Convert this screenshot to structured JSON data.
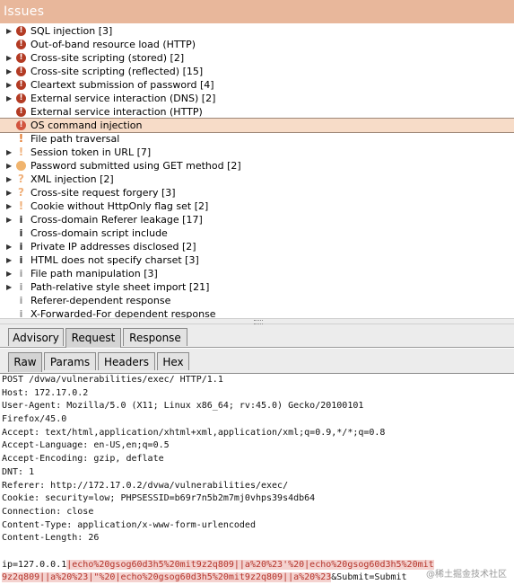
{
  "header": {
    "title": "Issues"
  },
  "issues": [
    {
      "label": "SQL injection [3]",
      "icon": "high-severity-icon",
      "severity": "high",
      "expandable": true
    },
    {
      "label": "Out-of-band resource load (HTTP)",
      "icon": "high-severity-icon",
      "severity": "high",
      "expandable": false
    },
    {
      "label": "Cross-site scripting (stored) [2]",
      "icon": "high-severity-icon",
      "severity": "high",
      "expandable": true
    },
    {
      "label": "Cross-site scripting (reflected) [15]",
      "icon": "high-severity-icon",
      "severity": "high",
      "expandable": true
    },
    {
      "label": "Cleartext submission of password [4]",
      "icon": "high-severity-icon",
      "severity": "high",
      "expandable": true
    },
    {
      "label": "External service interaction (DNS) [2]",
      "icon": "high-severity-icon",
      "severity": "high",
      "expandable": true
    },
    {
      "label": "External service interaction (HTTP)",
      "icon": "high-severity-icon",
      "severity": "high",
      "expandable": false
    },
    {
      "label": "OS command injection",
      "icon": "high-severity-icon",
      "severity": "high-selected",
      "expandable": false,
      "selected": true
    },
    {
      "label": "File path traversal",
      "icon": "medium-severity-icon",
      "severity": "medium",
      "expandable": false
    },
    {
      "label": "Session token in URL [7]",
      "icon": "low-severity-icon",
      "severity": "low",
      "expandable": true
    },
    {
      "label": "Password submitted using GET method [2]",
      "icon": "medium-circle-icon",
      "severity": "circle-orange",
      "expandable": true
    },
    {
      "label": "XML injection [2]",
      "icon": "question-icon",
      "severity": "low",
      "expandable": true
    },
    {
      "label": "Cross-site request forgery [3]",
      "icon": "question-icon",
      "severity": "low",
      "expandable": true
    },
    {
      "label": "Cookie without HttpOnly flag set [2]",
      "icon": "low-severity-icon",
      "severity": "low",
      "expandable": true
    },
    {
      "label": "Cross-domain Referer leakage [17]",
      "icon": "info-icon",
      "severity": "info",
      "expandable": true
    },
    {
      "label": "Cross-domain script include",
      "icon": "info-icon",
      "severity": "info",
      "expandable": false
    },
    {
      "label": "Private IP addresses disclosed [2]",
      "icon": "info-icon",
      "severity": "info",
      "expandable": true
    },
    {
      "label": "HTML does not specify charset [3]",
      "icon": "info-icon",
      "severity": "info",
      "expandable": true
    },
    {
      "label": "File path manipulation [3]",
      "icon": "info-icon",
      "severity": "info-faint",
      "expandable": true
    },
    {
      "label": "Path-relative style sheet import [21]",
      "icon": "info-icon",
      "severity": "info-faint",
      "expandable": true
    },
    {
      "label": "Referer-dependent response",
      "icon": "info-icon",
      "severity": "info-faint",
      "expandable": false
    },
    {
      "label": "X-Forwarded-For dependent response",
      "icon": "info-icon",
      "severity": "info-faint",
      "expandable": false
    }
  ],
  "tabs_top": [
    {
      "label": "Advisory",
      "active": false
    },
    {
      "label": "Request",
      "active": true
    },
    {
      "label": "Response",
      "active": false
    }
  ],
  "tabs_sub": [
    {
      "label": "Raw",
      "active": true
    },
    {
      "label": "Params",
      "active": false
    },
    {
      "label": "Headers",
      "active": false
    },
    {
      "label": "Hex",
      "active": false
    }
  ],
  "request": {
    "lines": [
      "POST /dvwa/vulnerabilities/exec/ HTTP/1.1",
      "Host: 172.17.0.2",
      "User-Agent: Mozilla/5.0 (X11; Linux x86_64; rv:45.0) Gecko/20100101",
      "Firefox/45.0",
      "Accept: text/html,application/xhtml+xml,application/xml;q=0.9,*/*;q=0.8",
      "Accept-Language: en-US,en;q=0.5",
      "Accept-Encoding: gzip, deflate",
      "DNT: 1",
      "Referer: http://172.17.0.2/dvwa/vulnerabilities/exec/",
      "Cookie: security=low; PHPSESSID=b69r7n5b2m7mj0vhps39s4db64",
      "Connection: close",
      "Content-Type: application/x-www-form-urlencoded",
      "Content-Length: 26",
      ""
    ],
    "body_line1_prefix": "ip=127.0.0.1",
    "body_line1_highlight": "|echo%20gsog60d3h5%20mit9z2q809||a%20%23'%20|echo%20gsog60d3h5%20mit",
    "body_line2_highlight": "9z2q809||a%20%23|\"%20|echo%20gsog60d3h5%20mit9z2q809||a%20%23",
    "body_line2_suffix": "&Submit=Submit"
  },
  "watermark": "@稀土掘金技术社区",
  "colors": {
    "header_bg": "#e8b79b",
    "selected_row": "#f7dcc8",
    "high": "#b33b24",
    "highlight_bg": "#f4d2cf",
    "highlight_text": "#b4332a"
  }
}
